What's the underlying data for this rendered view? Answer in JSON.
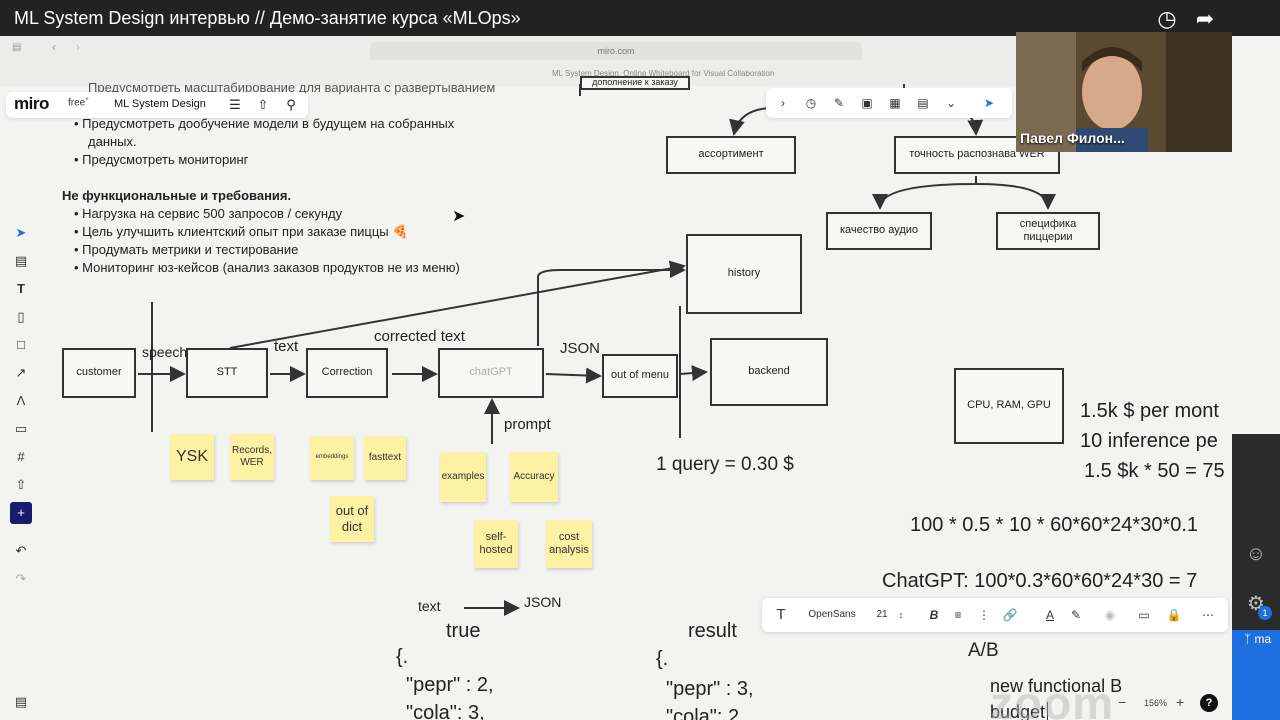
{
  "video": {
    "title": "ML System Design интервью // Демо-занятие курса «MLOps»"
  },
  "browser": {
    "url": "miro.com",
    "tab_title": "ML System Design, Online Whiteboard for Visual Collaboration"
  },
  "miro": {
    "logo": "miro",
    "plan": "free",
    "board_name": "ML System Design"
  },
  "notes": {
    "top_cut": "Предусмотреть масштабирование для варианта с развертыванием",
    "items_top": [
      "Предусмотреть дообучение модели в будущем на собранных",
      "данных.",
      "Предусмотреть мониторинг"
    ],
    "heading": "Не функциональные и требования.",
    "items": [
      "Нагрузка на сервис 500 запросов / секунду",
      "Цель улучшить клиентский опыт при заказе пиццы 🍕",
      "Продумать метрики и тестирование",
      "Мониторинг юз-кейсов (анализ заказов продуктов не из меню)"
    ]
  },
  "tree": {
    "top_left": "дополнение к заказу",
    "assortment": "ассортимент",
    "accuracy": "точность распознава WER",
    "audio_quality": "качество аудио",
    "pizzeria_specifics": "специфика пиццерии"
  },
  "pipeline": {
    "customer": "customer",
    "speech": "speech",
    "stt": "STT",
    "text": "text",
    "correction": "Correction",
    "corrected_text": "corrected text",
    "chatgpt": "chatGPT",
    "json": "JSON",
    "out_of_menu": "out of menu",
    "backend": "backend",
    "history": "history",
    "prompt": "prompt"
  },
  "stickies": {
    "ysk": "YSK",
    "records": "Records, WER",
    "embeddings": "embeddings",
    "fasttext": "fasttext",
    "out_of_dict": "out of dict",
    "examples": "examples",
    "accuracy": "Accuracy",
    "self_hosted": "self-hosted",
    "cost_analysis": "cost analysis"
  },
  "costs": {
    "query": "1 query = 0.30 $",
    "hw_box": "CPU, RAM, GPU",
    "line1": "1.5k $ per mont",
    "line2": "10 inference pe",
    "line3": "1.5 $k * 50 = 75",
    "formula1": "100 * 0.5 * 10 * 60*60*24*30*0.1",
    "formula2": "ChatGPT: 100*0.3*60*60*24*30 = 7"
  },
  "bottom": {
    "text": "text",
    "json": "JSON",
    "true_label": "true",
    "result_label": "result",
    "brace1": "{.",
    "brace2": "{.",
    "pepr_true": "\"pepr\" : 2,",
    "cola_true": "\"cola\": 3,",
    "pepr_result": "\"pepr\" : 3,",
    "cola_result": "\"cola\": 2",
    "ab": "A/B",
    "new_func": "new functional B",
    "budget": "budget"
  },
  "text_toolbar": {
    "font": "OpenSans",
    "size": "21"
  },
  "zoom_level": "156%",
  "webcam": {
    "name": "Павел Филон..."
  },
  "watermark": "zoom",
  "right_panel": {
    "badge": "1",
    "label": "ma"
  }
}
